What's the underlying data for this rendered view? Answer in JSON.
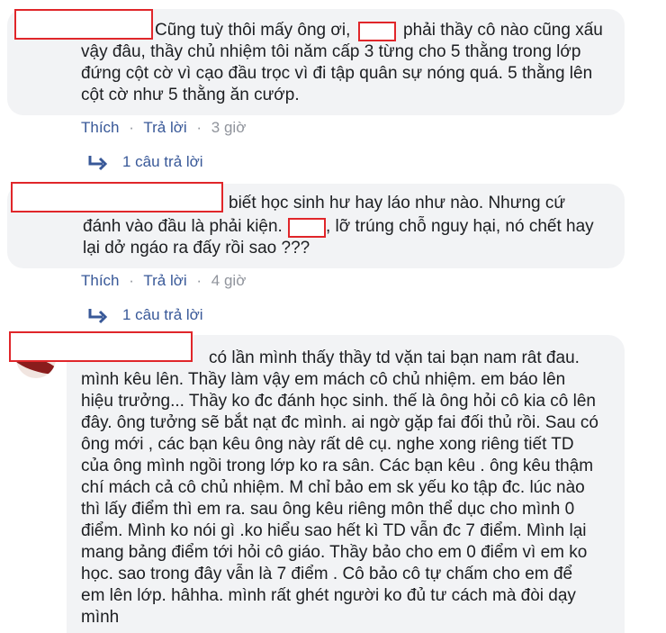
{
  "comments": [
    {
      "text": "Cũng tuỳ thôi mấy ông ơi, [redacted] phải thầy cô nào cũng xấu",
      "line1": "Cũng tuỳ thôi mấy ông ơi,",
      "line1b": "phải thầy cô nào cũng xấu",
      "rest": "vậy đâu, thầy chủ nhiệm tôi năm cấp 3 từng cho 5 thằng trong lớp\nđứng cột cờ vì cạo đầu trọc vì đi tập quân sự nóng quá. 5 thằng lên\ncột cờ như 5 thằng ăn cướp.",
      "like": "Thích",
      "reply": "Trả lời",
      "time": "3 giờ",
      "replies_link": "1 câu trả lời"
    },
    {
      "line1": "biết học sinh hư hay láo như nào. Nhưng cứ",
      "line2a": "đánh vào đầu là phải kiện.",
      "line2b": ", lỡ trúng chỗ nguy hại, nó chết hay",
      "line3": "lại dở ngáo ra đấy rồi sao ???",
      "like": "Thích",
      "reply": "Trả lời",
      "time": "4 giờ",
      "replies_link": "1 câu trả lời"
    },
    {
      "line1": "có lần mình thấy thầy td vặn tai bạn nam rât đau.",
      "rest": "mình kêu lên. Thầy làm vậy em mách cô chủ nhiệm. em báo lên\nhiệu trưởng... Thầy ko đc đánh học sinh. thế là ông hỏi cô kia cô lên\nđây. ông tưởng sẽ bắt nạt đc mình. ai ngờ gặp fai đối thủ rồi. Sau có\nông mới , các bạn kêu ông này rất dê cụ. nghe xong riêng tiết TD\ncủa ông mình ngồi trong lớp ko ra sân. Các bạn kêu . ông kêu thậm\nchí mách cả cô chủ nhiệm. M chỉ bảo em sk yếu ko tập đc. lúc nào\nthì lấy điểm thì em ra. sau ông kêu riêng môn thể dục cho mình 0\nđiểm. Mình ko nói gì .ko hiểu sao hết kì TD vẫn đc 7 điểm. Mình lại\nmang bảng điểm tới hỏi cô giáo. Thầy bảo cho em 0 điểm vì em ko\nhọc. sao trong đây vẫn là 7 điểm . Cô bảo cô tự chấm cho em để\nem lên lớp. hâhha. mình rất ghét người ko đủ tư cách mà đòi dạy\nmình"
    }
  ],
  "separator": "·",
  "colors": {
    "link": "#385898",
    "meta": "#90949c",
    "bubble": "#f2f3f5",
    "redact_border": "#e0262a"
  }
}
